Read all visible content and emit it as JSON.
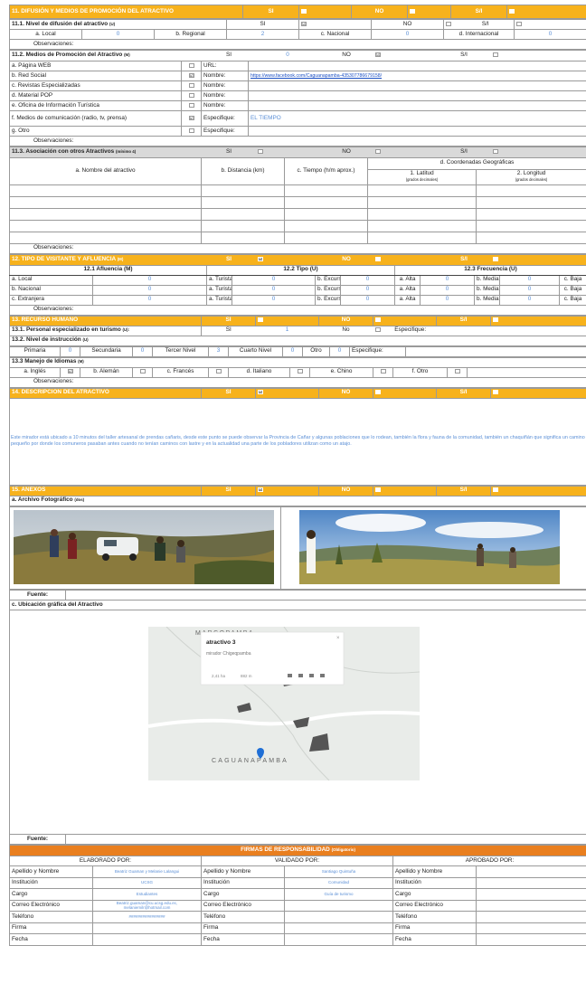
{
  "sec11": {
    "title": "11. DIFUSIÓN Y MEDIOS DE PROMOCIÓN DEL ATRACTIVO",
    "si": "SI",
    "no": "NO",
    "si_mark": "",
    "no_mark": "",
    "sn": "S/I",
    "sn_mark": ""
  },
  "s111": {
    "title": "11.1. Nivel de difusión del atractivo",
    "tag": "(U)",
    "si": "SI",
    "no": "NO",
    "sn": "S/I",
    "si_mark": "☑",
    "no_mark": "",
    "sn_mark": "",
    "local_l": "a. Local",
    "local_v": "0",
    "regional_l": "b. Regional",
    "regional_v": "2",
    "nacional_l": "c. Nacional",
    "nacional_v": "0",
    "intl_l": "d. Internacional",
    "intl_v": "0",
    "obs": "Observaciones:"
  },
  "s112": {
    "title": "11.2. Medios de Promoción del Atractivo",
    "tag": "(M)",
    "si": "SI",
    "si_v": "0",
    "no": "NO",
    "no_mark": "☑",
    "sn": "S/I",
    "sn_mark": "",
    "rows": [
      {
        "label": "a. Página WEB",
        "mark": "",
        "field": "URL:",
        "value": ""
      },
      {
        "label": "b. Red Social",
        "mark": "☑",
        "field": "Nombre:",
        "value": "https://www.facebook.com/Caguanapamba-435307786679158/"
      },
      {
        "label": "c. Revistas Especializadas",
        "mark": "",
        "field": "Nombre:",
        "value": ""
      },
      {
        "label": "d. Material POP",
        "mark": "",
        "field": "Nombre:",
        "value": ""
      },
      {
        "label": "e. Oficina de Información Turística",
        "mark": "",
        "field": "Nombre:",
        "value": ""
      },
      {
        "label": "f. Medios de comunicación (radio, tv, prensa)",
        "mark": "☑",
        "field": "Especifique:",
        "value": "EL TIEMPO"
      },
      {
        "label": "g. Otro",
        "mark": "",
        "field": "Especifique:",
        "value": ""
      }
    ],
    "obs": "Observaciones:"
  },
  "s113": {
    "title": "11.3. Asociación con otros Atractivos",
    "tag": "(mínimo 4)",
    "si": "SI",
    "si_mark": "",
    "no": "NO",
    "no_mark": "",
    "sn": "S/I",
    "sn_mark": "",
    "col_name": "a. Nombre del atractivo",
    "col_dist": "b. Distancia (km)",
    "col_time": "c. Tiempo (h/m aprox.)",
    "col_coord": "d. Coordenadas Geográficas",
    "col_lat": "1. Latitud",
    "col_lat_sub": "(grados decimales)",
    "col_lon": "2. Longitud",
    "col_lon_sub": "(grados decimales)",
    "obs": "Observaciones:"
  },
  "sec12": {
    "title": "12. TIPO DE VISITANTE Y AFLUENCIA",
    "tag": "(M)",
    "si": "SI",
    "si_mark": "☑",
    "no": "NO",
    "no_mark": "",
    "sn": "S/I",
    "sn_mark": "",
    "h_af": "12.1 Afluencia (M)",
    "h_tipo": "12.2 Tipo (U)",
    "h_freq": "12.3 Frecuencia (U)",
    "rows": [
      {
        "label": "a. Local",
        "v": "0",
        "t1": "a. Turista",
        "t1v": "0",
        "t2": "b. Excursionista",
        "t2v": "0",
        "f1": "a. Alta",
        "f1v": "0",
        "f2": "b. Media",
        "f2v": "0",
        "f3": "c. Baja",
        "f3v": "0"
      },
      {
        "label": "b. Nacional",
        "v": "0",
        "t1": "a. Turista",
        "t1v": "0",
        "t2": "b. Excursionista",
        "t2v": "0",
        "f1": "a. Alta",
        "f1v": "0",
        "f2": "b. Media",
        "f2v": "0",
        "f3": "c. Baja",
        "f3v": "0"
      },
      {
        "label": "c. Extranjera",
        "v": "0",
        "t1": "a. Turista",
        "t1v": "0",
        "t2": "b. Excursionista",
        "t2v": "0",
        "f1": "a. Alta",
        "f1v": "0",
        "f2": "b. Media",
        "f2v": "0",
        "f3": "c. Baja",
        "f3v": "0"
      }
    ],
    "obs": "Observaciones:"
  },
  "sec13": {
    "title": "13. RECURSO HUMANO",
    "si": "SI",
    "si_mark": "",
    "no": "NO",
    "no_mark": "",
    "sn": "S/I",
    "sn_mark": "",
    "p131": "13.1. Personal especializado en turismo",
    "p131_tag": "(U):",
    "p131_si": "SI",
    "p131_si_v": "1",
    "p131_no": "No",
    "p131_no_mark": "",
    "p131_spec": "Especifique:",
    "p132": "13.2. Nivel de instrucción",
    "p132_tag": "(U)",
    "edu": [
      {
        "label": "Primaria",
        "v": "0"
      },
      {
        "label": "Secundaria",
        "v": "0"
      },
      {
        "label": "Tercer Nivel",
        "v": "3"
      },
      {
        "label": "Cuarto Nivel",
        "v": "0"
      },
      {
        "label": "Otro",
        "v": "0"
      }
    ],
    "edu_spec": "Especifique:",
    "p133": "13.3 Manejo de Idiomas",
    "p133_tag": "(M)",
    "langs": [
      {
        "label": "a. Inglés",
        "mark": "☑"
      },
      {
        "label": "b. Alemán",
        "mark": ""
      },
      {
        "label": "c. Francés",
        "mark": ""
      },
      {
        "label": "d. Italiano",
        "mark": ""
      },
      {
        "label": "e. Chino",
        "mark": ""
      },
      {
        "label": "f. Otro",
        "mark": ""
      }
    ],
    "obs": "Observaciones:"
  },
  "sec14": {
    "title": "14. DESCRIPCION DEL ATRACTIVO",
    "si": "SI",
    "si_mark": "☑",
    "no": "NO",
    "no_mark": "",
    "sn": "S/I",
    "sn_mark": "",
    "text": "Este mirador está ubicado a 10 minutos del taller artesanal de prendas cañaris, desde este punto se puede observar la Provincia de Cañar y algunas poblaciones que lo rodean, también la flora y fauna de la comunidad, también un chaquiñán que significa un camino pequeño por donde los comuneros pasaban antes cuando no tenían caminos con lastre y en la actualidad una parte de los pobladores utilizan como un atajo."
  },
  "sec15": {
    "title": "15. ANEXOS",
    "si": "SI",
    "si_mark": "☑",
    "no": "NO",
    "no_mark": "",
    "sn": "S/I",
    "sn_mark": "",
    "a_title": "a. Archivo Fotográfico",
    "a_tag": "(dos)",
    "fuente": "Fuente:",
    "c_title": "c. Ubicación gráfica del Atractivo",
    "fuente2": "Fuente:",
    "map": {
      "place_top": "MARCOPAMBA",
      "place_bottom": "CAGUANAPAMBA",
      "popup_title": "atractivo 3",
      "popup_sub": "mirador Chigeqpamba",
      "popup_ha": "2,41 ha",
      "popup_m": "882 m",
      "popup_close": "×"
    }
  },
  "firmas": {
    "title": "FIRMAS DE RESPONSABILIDAD",
    "tag": "(Obligatorio)",
    "elab": "ELABORADO POR:",
    "valid": "VALIDADO POR:",
    "aprob": "APROBADO POR:",
    "labels": [
      "Apellido y Nombre",
      "Institución",
      "Cargo",
      "Correo Electrónico",
      "Teléfono",
      "Firma",
      "Fecha"
    ],
    "elab_vals": [
      "Beatriz Guaman y Melanie Lalangui",
      "UCSG",
      "Estudiantes",
      "Beatriz.guaman@cu.ucsg.edu.ec, melaniemilr@hotmail.com",
      "################",
      "",
      ""
    ],
    "valid_vals": [
      "Santiago Quintuña",
      "Comunidad",
      "Guía de turismo",
      "",
      "",
      "",
      ""
    ],
    "aprob_vals": [
      "",
      "",
      "",
      "",
      "",
      "",
      ""
    ]
  }
}
